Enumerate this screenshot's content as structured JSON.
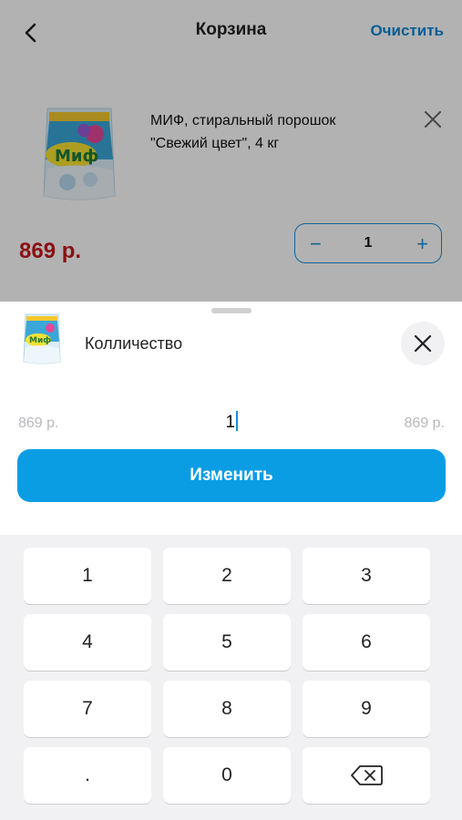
{
  "header": {
    "title": "Корзина",
    "clear_label": "Очистить",
    "back_icon": "chevron-left-icon"
  },
  "cart_item": {
    "name": "МИФ, стиральный порошок \"Свежий цвет\", 4 кг",
    "price": "869 р.",
    "quantity": "1",
    "minus": "−",
    "plus": "+",
    "remove_icon": "close-icon"
  },
  "sheet": {
    "title": "Колличество",
    "unit_price": "869 р.",
    "quantity_value": "1",
    "total_price": "869 р.",
    "submit_label": "Изменить",
    "close_icon": "close-icon"
  },
  "keypad": {
    "keys": [
      "1",
      "2",
      "3",
      "4",
      "5",
      "6",
      "7",
      "8",
      "9",
      ".",
      "0"
    ],
    "backspace_icon": "backspace-icon"
  },
  "colors": {
    "accent": "#0a9de4",
    "price_red": "#c8171e",
    "link_blue": "#0a86d6"
  }
}
